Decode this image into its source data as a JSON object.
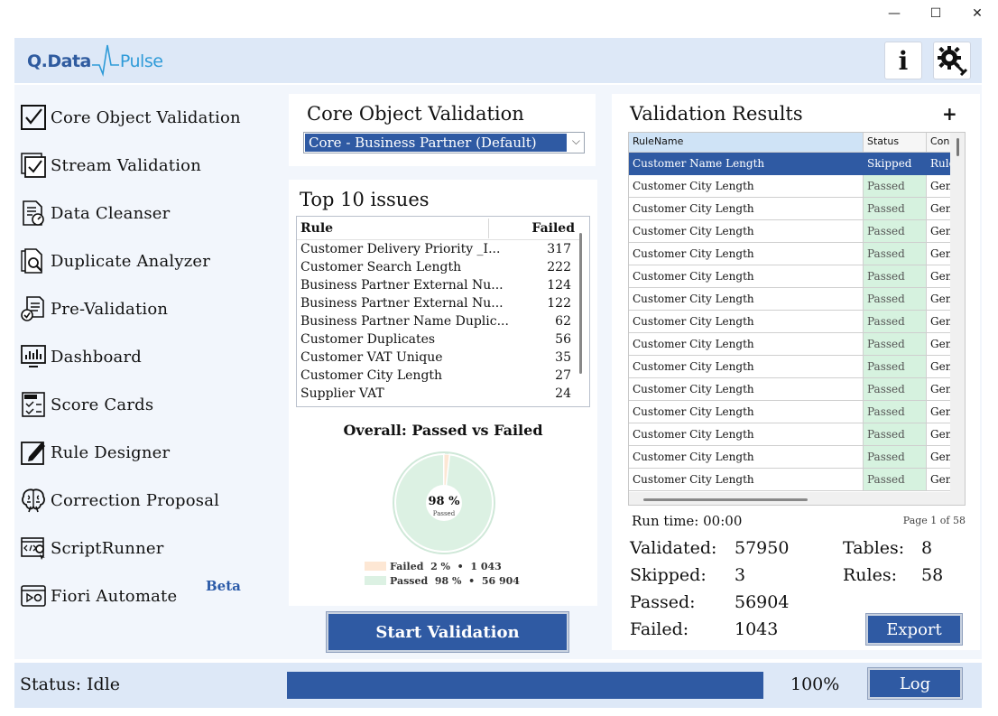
{
  "window": {
    "minimize_glyph": "—",
    "maximize_glyph": "☐",
    "close_glyph": "✕"
  },
  "header": {
    "logo_left": "Q.Data",
    "logo_right": "Pulse",
    "info_label": "i",
    "settings_icon": "gear-wrench-icon"
  },
  "sidebar": {
    "items": [
      {
        "label": "Core Object Validation",
        "icon": "checkbox-icon"
      },
      {
        "label": "Stream Validation",
        "icon": "stacked-checkbox-icon"
      },
      {
        "label": "Data Cleanser",
        "icon": "document-gauge-icon"
      },
      {
        "label": "Duplicate Analyzer",
        "icon": "document-search-icon"
      },
      {
        "label": "Pre-Validation",
        "icon": "document-check-icon"
      },
      {
        "label": "Dashboard",
        "icon": "dashboard-icon"
      },
      {
        "label": "Score Cards",
        "icon": "score-card-icon"
      },
      {
        "label": "Rule Designer",
        "icon": "pencil-icon"
      },
      {
        "label": "Correction Proposal",
        "icon": "brain-icon"
      },
      {
        "label": "ScriptRunner",
        "icon": "script-gear-icon"
      },
      {
        "label": "Fiori Automate",
        "icon": "window-play-icon"
      }
    ],
    "beta_label": "Beta"
  },
  "core_validation": {
    "title": "Core Object Validation",
    "selected_object": "Core - Business Partner (Default)"
  },
  "top_issues": {
    "title": "Top 10 issues",
    "col_rule": "Rule",
    "col_failed": "Failed",
    "rows": [
      {
        "rule": "Customer Delivery Priority _I...",
        "failed": "317"
      },
      {
        "rule": "Customer Search Length",
        "failed": "222"
      },
      {
        "rule": "Business Partner External Nu...",
        "failed": "124"
      },
      {
        "rule": "Business Partner External Nu...",
        "failed": "122"
      },
      {
        "rule": "Business Partner Name Duplic...",
        "failed": "62"
      },
      {
        "rule": "Customer Duplicates",
        "failed": "56"
      },
      {
        "rule": "Customer VAT Unique",
        "failed": "35"
      },
      {
        "rule": "Customer City Length",
        "failed": "27"
      },
      {
        "rule": "Supplier VAT",
        "failed": "24"
      }
    ]
  },
  "chart_data": {
    "type": "pie",
    "title": "Overall: Passed vs Failed",
    "center_value": "98 %",
    "center_label": "Passed",
    "slices": [
      {
        "name": "Failed",
        "percent_label": "2 %",
        "value_label": "1 043",
        "value": 1043,
        "color": "#fde7d4"
      },
      {
        "name": "Passed",
        "percent_label": "98 %",
        "value_label": "56 904",
        "value": 56904,
        "color": "#dcf1e3"
      }
    ],
    "separator": "•"
  },
  "start_button": "Start Validation",
  "results": {
    "title": "Validation Results",
    "add_label": "+",
    "columns": [
      "RuleName",
      "Status",
      "Con"
    ],
    "rows": [
      {
        "rule": "Customer Name Length",
        "status": "Skipped",
        "col3": "Rule",
        "selected": true
      },
      {
        "rule": "Customer City Length",
        "status": "Passed",
        "col3": "Gen"
      },
      {
        "rule": "Customer City Length",
        "status": "Passed",
        "col3": "Gen"
      },
      {
        "rule": "Customer City Length",
        "status": "Passed",
        "col3": "Gen"
      },
      {
        "rule": "Customer City Length",
        "status": "Passed",
        "col3": "Gen"
      },
      {
        "rule": "Customer City Length",
        "status": "Passed",
        "col3": "Gen"
      },
      {
        "rule": "Customer City Length",
        "status": "Passed",
        "col3": "Gen"
      },
      {
        "rule": "Customer City Length",
        "status": "Passed",
        "col3": "Gen"
      },
      {
        "rule": "Customer City Length",
        "status": "Passed",
        "col3": "Gen"
      },
      {
        "rule": "Customer City Length",
        "status": "Passed",
        "col3": "Gen"
      },
      {
        "rule": "Customer City Length",
        "status": "Passed",
        "col3": "Gen"
      },
      {
        "rule": "Customer City Length",
        "status": "Passed",
        "col3": "Gen"
      },
      {
        "rule": "Customer City Length",
        "status": "Passed",
        "col3": "Gen"
      },
      {
        "rule": "Customer City Length",
        "status": "Passed",
        "col3": "Gen"
      },
      {
        "rule": "Customer City Length",
        "status": "Passed",
        "col3": "Gen"
      }
    ],
    "run_time": "Run time: 00:00",
    "page_info": "Page 1 of 58",
    "stats": {
      "validated_label": "Validated:",
      "validated": "57950",
      "skipped_label": "Skipped:",
      "skipped": "3",
      "passed_label": "Passed:",
      "passed": "56904",
      "failed_label": "Failed:",
      "failed": "1043",
      "tables_label": "Tables:",
      "tables": "8",
      "rules_label": "Rules:",
      "rules": "58"
    },
    "export_label": "Export"
  },
  "footer": {
    "status": "Status: Idle",
    "progress": 1.0,
    "progress_label": "100%",
    "log_label": "Log"
  },
  "colors": {
    "accent": "#2f5aa3",
    "panel_bg": "#f2f6fc",
    "header_bg": "#dde8f7",
    "passed_cell": "#d6f2df"
  }
}
